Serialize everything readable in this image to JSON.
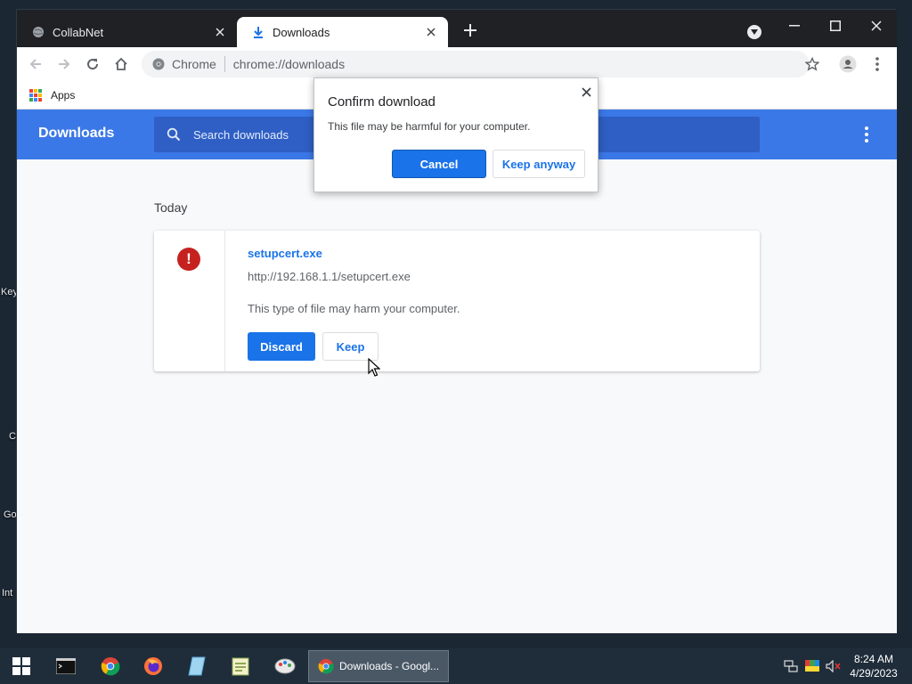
{
  "desktop": {
    "labels": [
      "Key",
      "C",
      "Go",
      "Int"
    ]
  },
  "tabs": [
    {
      "title": "CollabNet",
      "icon": "globe-icon",
      "active": false
    },
    {
      "title": "Downloads",
      "icon": "download-icon",
      "active": true
    }
  ],
  "toolbar": {
    "scheme_label": "Chrome",
    "url": "chrome://downloads"
  },
  "bookmarks": {
    "apps_label": "Apps"
  },
  "downloads_page": {
    "title": "Downloads",
    "search_placeholder": "Search downloads",
    "section_label": "Today",
    "item": {
      "file_name": "setupcert.exe",
      "url": "http://192.168.1.1/setupcert.exe",
      "warning": "This type of file may harm your computer.",
      "discard_label": "Discard",
      "keep_label": "Keep"
    }
  },
  "dialog": {
    "title": "Confirm download",
    "message": "This file may be harmful for your computer.",
    "cancel_label": "Cancel",
    "keep_anyway_label": "Keep anyway"
  },
  "taskbar": {
    "active_window_label": "Downloads - Googl...",
    "time": "8:24 AM",
    "date": "4/29/2023"
  },
  "colors": {
    "header_blue": "#3b78e7",
    "link_blue": "#1a73e8",
    "danger_red": "#c5221f",
    "tabstrip": "#202124"
  }
}
